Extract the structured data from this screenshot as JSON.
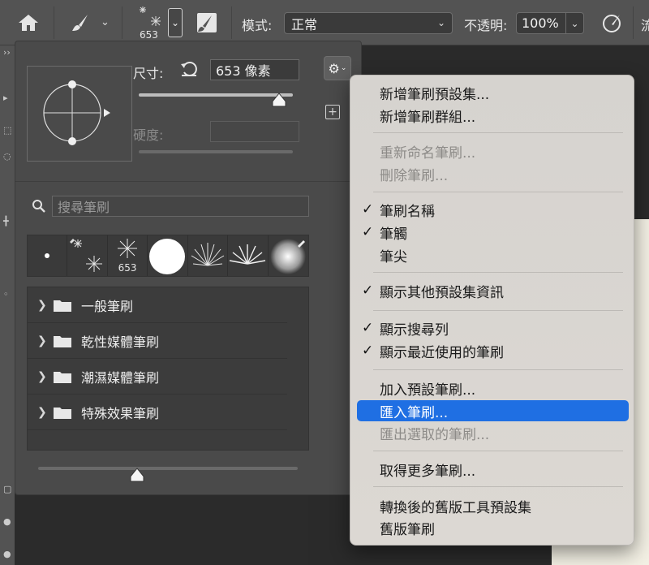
{
  "topbar": {
    "brush_size_value": "653",
    "mode_label": "模式:",
    "mode_value": "正常",
    "opacity_label": "不透明:",
    "opacity_value": "100%",
    "cut_label": "流"
  },
  "brush_panel": {
    "size_label": "尺寸:",
    "size_value": "653 像素",
    "size_slider_fraction": 0.91,
    "hardness_label": "硬度:",
    "search_placeholder": "搜尋筆刷",
    "recent_brushes": [
      {
        "name": "round-small",
        "label": ""
      },
      {
        "name": "snowflake-small",
        "label": ""
      },
      {
        "name": "snowflake-653",
        "label": "653"
      },
      {
        "name": "hard-round",
        "label": ""
      },
      {
        "name": "spatter-fan-1",
        "label": ""
      },
      {
        "name": "spatter-fan-2",
        "label": ""
      },
      {
        "name": "soft-round",
        "label": ""
      }
    ],
    "folders": [
      {
        "label": "一般筆刷"
      },
      {
        "label": "乾性媒體筆刷"
      },
      {
        "label": "潮濕媒體筆刷"
      },
      {
        "label": "特殊效果筆刷"
      }
    ],
    "preview_slider_fraction": 0.38
  },
  "menu": {
    "groups": [
      [
        {
          "label": "新增筆刷預設集...",
          "checked": false,
          "disabled": false
        },
        {
          "label": "新增筆刷群組...",
          "checked": false,
          "disabled": false
        }
      ],
      [
        {
          "label": "重新命名筆刷...",
          "checked": false,
          "disabled": true
        },
        {
          "label": "刪除筆刷...",
          "checked": false,
          "disabled": true
        }
      ],
      [
        {
          "label": "筆刷名稱",
          "checked": true,
          "disabled": false
        },
        {
          "label": "筆觸",
          "checked": true,
          "disabled": false
        },
        {
          "label": "筆尖",
          "checked": false,
          "disabled": false
        }
      ],
      [
        {
          "label": "顯示其他預設集資訊",
          "checked": true,
          "disabled": false
        }
      ],
      [
        {
          "label": "顯示搜尋列",
          "checked": true,
          "disabled": false
        },
        {
          "label": "顯示最近使用的筆刷",
          "checked": true,
          "disabled": false
        }
      ],
      [
        {
          "label": "加入預設筆刷...",
          "checked": false,
          "disabled": false
        },
        {
          "label": "匯入筆刷...",
          "checked": false,
          "disabled": false,
          "active": true
        },
        {
          "label": "匯出選取的筆刷...",
          "checked": false,
          "disabled": true
        }
      ],
      [
        {
          "label": "取得更多筆刷...",
          "checked": false,
          "disabled": false
        }
      ],
      [
        {
          "label": "轉換後的舊版工具預設集",
          "checked": false,
          "disabled": false
        },
        {
          "label": "舊版筆刷",
          "checked": false,
          "disabled": false
        }
      ]
    ],
    "check_glyph": "✓"
  },
  "colors": {
    "accent": "#1f6fe3"
  }
}
